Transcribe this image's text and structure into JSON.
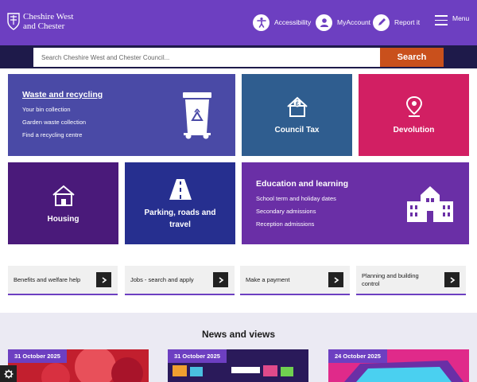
{
  "header": {
    "logo_line1": "Cheshire West",
    "logo_line2": "and Chester",
    "accessibility": "Accessibility",
    "my_account": "MyAccount",
    "report_it": "Report it",
    "menu": "Menu"
  },
  "search": {
    "placeholder": "Search Cheshire West and Chester Council...",
    "button": "Search"
  },
  "tiles": {
    "waste": {
      "title": "Waste and recycling",
      "links": [
        "Your bin collection",
        "Garden waste collection",
        "Find a recycling centre"
      ]
    },
    "council_tax": {
      "title": "Council Tax"
    },
    "devolution": {
      "title": "Devolution"
    },
    "housing": {
      "title": "Housing"
    },
    "parking": {
      "title_line1": "Parking, roads and",
      "title_line2": "travel"
    },
    "education": {
      "title": "Education and learning",
      "links": [
        "School term and holiday dates",
        "Secondary admissions",
        "Reception admissions"
      ]
    }
  },
  "quick_links": [
    {
      "line1": "Benefits and welfare help",
      "line2": ""
    },
    {
      "line1": "Jobs - search and apply",
      "line2": ""
    },
    {
      "line1": "Make a payment",
      "line2": ""
    },
    {
      "line1": "Planning and building",
      "line2": "control"
    }
  ],
  "news": {
    "title": "News and views",
    "cards": [
      {
        "date": "31 October 2025"
      },
      {
        "date": "31 October 2025"
      },
      {
        "date": "24 October 2025"
      }
    ]
  },
  "colors": {
    "brand_purple": "#6d3fc1",
    "navy": "#1e1a4a",
    "search_orange": "#c9501c",
    "tile_blue": "#4a4aa6",
    "tile_teal": "#2f5d8f",
    "tile_pink": "#d21f63",
    "tile_dark_purple": "#4a1a7a",
    "tile_navy": "#262f8f",
    "tile_violet": "#6a2fa6"
  }
}
